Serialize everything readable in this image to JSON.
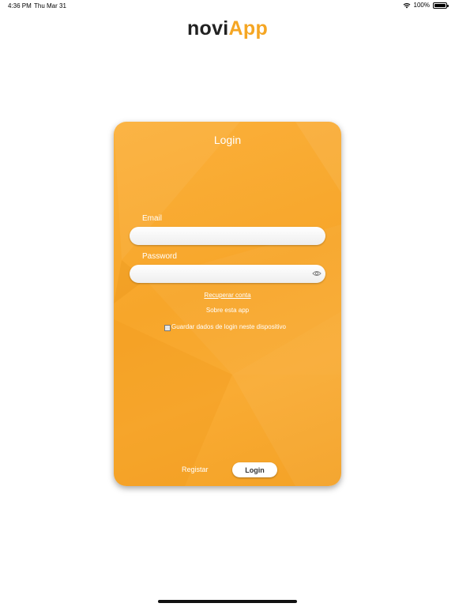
{
  "status_bar": {
    "time": "4:36 PM",
    "date": "Thu Mar 31",
    "battery": "100%"
  },
  "logo": {
    "part1": "novi",
    "part2": "App",
    "colors": {
      "dark": "#222222",
      "accent": "#f5a623"
    }
  },
  "login_card": {
    "title": "Login",
    "email_label": "Email",
    "email_value": "",
    "password_label": "Password",
    "password_value": "",
    "recover_link": "Recuperar conta",
    "about_link": "Sobre esta app",
    "remember_label": "Guardar dados de login neste dispositivo",
    "remember_checked": false,
    "register_button": "Registar",
    "login_button": "Login",
    "colors": {
      "card": "#f9ab33",
      "text": "#ffffff"
    }
  }
}
